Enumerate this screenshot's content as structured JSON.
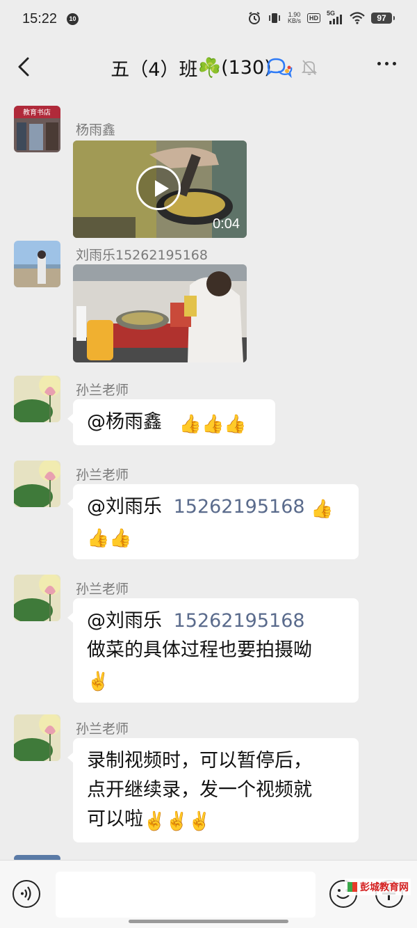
{
  "status": {
    "time": "15:22",
    "notification_badge": "10",
    "net_speed_value": "1.90",
    "net_speed_unit": "KB/s",
    "hd_label": "HD",
    "signal_label": "5G",
    "battery": "97"
  },
  "header": {
    "title": "五（4）班",
    "clover_icon": "☘️",
    "member_count": "(130)"
  },
  "messages": [
    {
      "sender": "杨雨鑫",
      "type": "video",
      "duration": "0:04"
    },
    {
      "sender": "刘雨乐15262195168",
      "type": "image"
    },
    {
      "sender": "孙兰老师",
      "type": "text",
      "mention": "@杨雨鑫",
      "emoji": "👍👍👍"
    },
    {
      "sender": "孙兰老师",
      "type": "text",
      "mention": "@刘雨乐",
      "phone": "15262195168",
      "emoji_a": "👍",
      "emoji_b": "👍👍"
    },
    {
      "sender": "孙兰老师",
      "type": "text",
      "mention": "@刘雨乐",
      "phone": "15262195168",
      "line2": "做菜的具体过程也要拍摄呦",
      "emoji": "✌️"
    },
    {
      "sender": "孙兰老师",
      "type": "text",
      "line1": "录制视频时，可以暂停后，",
      "line2": "点开继续录，发一个视频就",
      "line3": "可以啦",
      "emoji": "✌️✌️✌️"
    }
  ],
  "bottom_bar": {
    "input_placeholder": ""
  },
  "watermark": {
    "text": "彭城教育网"
  },
  "icons": {
    "back": "chevron-left-icon",
    "group": "group-chat-icon",
    "mute": "bell-off-icon",
    "more": "more-dots-icon",
    "voice": "voice-icon",
    "emoji": "smile-icon",
    "plus": "plus-icon"
  },
  "colors": {
    "background": "#ededed",
    "phone_link": "#5a6b8c",
    "sender_name": "#7a7a7a",
    "group_icon_blue": "#2f7bf6"
  }
}
